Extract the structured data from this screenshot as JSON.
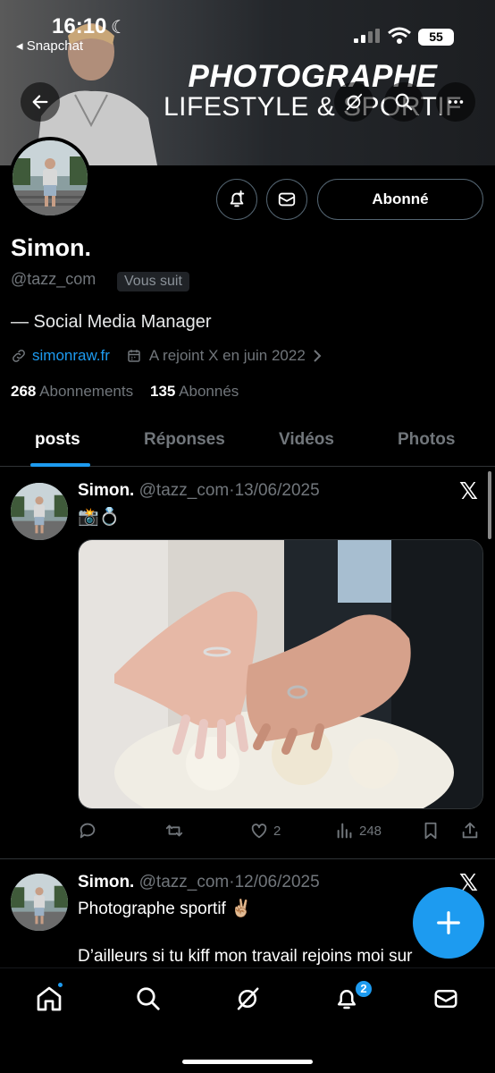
{
  "status_bar": {
    "time": "16:10",
    "back_app": "◂ Snapchat",
    "battery": "55"
  },
  "banner": {
    "line1": "PHOTOGRAPHE",
    "line2": "LIFESTYLE & SPORTIF"
  },
  "profile": {
    "name": "Simon.",
    "handle": "@tazz_com",
    "follows_you": "Vous suit",
    "follow_button": "Abonné",
    "bio": "— Social Media Manager",
    "website": "simonraw.fr",
    "joined": "A rejoint X en juin 2022",
    "following_count": "268",
    "following_label": "Abonnements",
    "followers_count": "135",
    "followers_label": "Abonnés"
  },
  "tabs": [
    {
      "label": "posts"
    },
    {
      "label": "Réponses"
    },
    {
      "label": "Vidéos"
    },
    {
      "label": "Photos"
    }
  ],
  "posts": [
    {
      "name": "Simon.",
      "handle": "@tazz_com",
      "date": "13/06/2025",
      "text": "📸💍",
      "replies": "",
      "reposts": "",
      "likes": "2",
      "views": "248"
    },
    {
      "name": "Simon.",
      "handle": "@tazz_com",
      "date": "12/06/2025",
      "text": "Photographe sportif ✌🏼",
      "text2": "D’ailleurs si tu kiff mon travail rejoins moi sur"
    }
  ],
  "bottom_nav": {
    "notifications_badge": "2"
  },
  "colors": {
    "accent": "#1d9bf0",
    "background": "#000000",
    "secondary_text": "#71767b"
  }
}
